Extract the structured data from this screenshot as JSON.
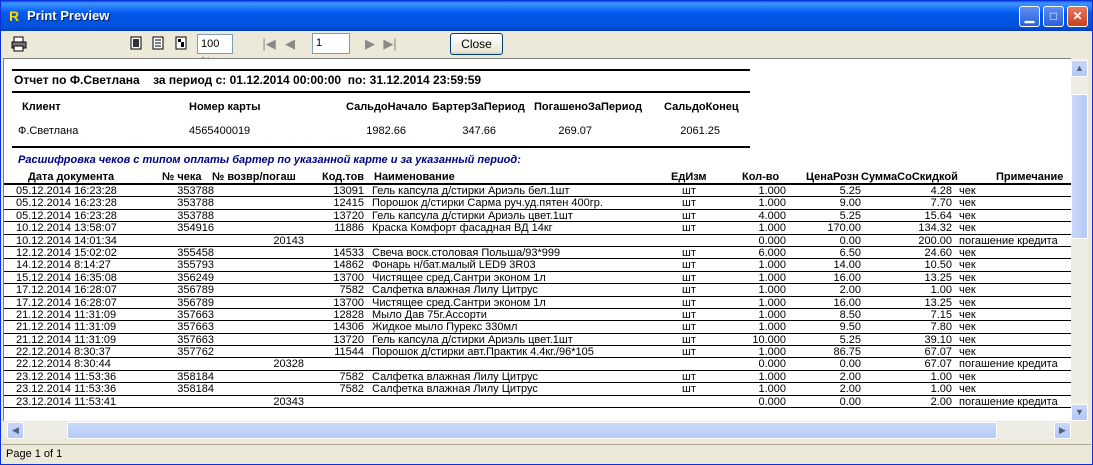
{
  "window": {
    "title": "Print Preview",
    "app_icon": "R"
  },
  "toolbar": {
    "zoom": "100 %",
    "page": "1",
    "close_label": "Close"
  },
  "report": {
    "header_line": "Отчет по Ф.Светлана    за период с: 01.12.2014 00:00:00  по: 31.12.2014 23:59:59",
    "summary_headers": [
      "Клиент",
      "Номер карты",
      "СальдоНачало",
      "БартерЗаПериод",
      "ПогашеноЗаПериод",
      "СальдоКонец"
    ],
    "summary_values": [
      "Ф.Светлана",
      "4565400019",
      "1982.66",
      "347.66",
      "269.07",
      "2061.25"
    ],
    "subtitle": "Расшифровка чеков с типом оплаты бартер по указанной карте и за указанный период:",
    "columns": [
      "Дата документа",
      "№ чека",
      "№ возвр/погаш",
      "Код.тов",
      "Наименование",
      "ЕдИзм",
      "Кол-во",
      "ЦенаРозн",
      "СуммаСоСкидкой",
      "Примечание"
    ],
    "rows": [
      [
        "05.12.2014 16:23:28",
        "353788",
        "",
        "13091",
        "Гель капсула д/стирки Ариэль бел.1шт",
        "шт",
        "1.000",
        "5.25",
        "4.28",
        "чек"
      ],
      [
        "05.12.2014 16:23:28",
        "353788",
        "",
        "12415",
        "Порошок д/стирки Сарма руч.уд.пятен 400гр.",
        "шт",
        "1.000",
        "9.00",
        "7.70",
        "чек"
      ],
      [
        "05.12.2014 16:23:28",
        "353788",
        "",
        "13720",
        "Гель капсула д/стирки Ариэль цвет.1шт",
        "шт",
        "4.000",
        "5.25",
        "15.64",
        "чек"
      ],
      [
        "10.12.2014 13:58:07",
        "354916",
        "",
        "11886",
        "Краска Комфорт фасадная ВД 14кг",
        "шт",
        "1.000",
        "170.00",
        "134.32",
        "чек"
      ],
      [
        "10.12.2014 14:01:34",
        "",
        "20143",
        "",
        "",
        "",
        "0.000",
        "0.00",
        "200.00",
        "погашение кредита"
      ],
      [
        "12.12.2014 15:02:02",
        "355458",
        "",
        "14533",
        "Свеча воск.столовая Польша/93*999",
        "шт",
        "6.000",
        "6.50",
        "24.60",
        "чек"
      ],
      [
        "14.12.2014 8:14:27",
        "355793",
        "",
        "14862",
        "Фонарь н/бат.малый LED9 3R03",
        "шт",
        "1.000",
        "14.00",
        "10.50",
        "чек"
      ],
      [
        "15.12.2014 16:35:08",
        "356249",
        "",
        "13700",
        "Чистящее сред.Сантри эконом 1л",
        "шт",
        "1.000",
        "16.00",
        "13.25",
        "чек"
      ],
      [
        "17.12.2014 16:28:07",
        "356789",
        "",
        "7582",
        "Салфетка влажная Лилу Цитрус",
        "шт",
        "1.000",
        "2.00",
        "1.00",
        "чек"
      ],
      [
        "17.12.2014 16:28:07",
        "356789",
        "",
        "13700",
        "Чистящее сред.Сантри эконом 1л",
        "шт",
        "1.000",
        "16.00",
        "13.25",
        "чек"
      ],
      [
        "21.12.2014 11:31:09",
        "357663",
        "",
        "12828",
        "Мыло Дав 75г.Ассорти",
        "шт",
        "1.000",
        "8.50",
        "7.15",
        "чек"
      ],
      [
        "21.12.2014 11:31:09",
        "357663",
        "",
        "14306",
        "Жидкое мыло Пурекс 330мл",
        "шт",
        "1.000",
        "9.50",
        "7.80",
        "чек"
      ],
      [
        "21.12.2014 11:31:09",
        "357663",
        "",
        "13720",
        "Гель капсула д/стирки Ариэль цвет.1шт",
        "шт",
        "10.000",
        "5.25",
        "39.10",
        "чек"
      ],
      [
        "22.12.2014 8:30:37",
        "357762",
        "",
        "11544",
        "Порошок д/стирки авт.Практик 4.4кг./96*105",
        "шт",
        "1.000",
        "86.75",
        "67.07",
        "чек"
      ],
      [
        "22.12.2014 8:30:44",
        "",
        "20328",
        "",
        "",
        "",
        "0.000",
        "0.00",
        "67.07",
        "погашение кредита"
      ],
      [
        "23.12.2014 11:53:36",
        "358184",
        "",
        "7582",
        "Салфетка влажная Лилу Цитрус",
        "шт",
        "1.000",
        "2.00",
        "1.00",
        "чек"
      ],
      [
        "23.12.2014 11:53:36",
        "358184",
        "",
        "7582",
        "Салфетка влажная Лилу Цитрус",
        "шт",
        "1.000",
        "2.00",
        "1.00",
        "чек"
      ],
      [
        "23.12.2014 11:53:41",
        "",
        "20343",
        "",
        "",
        "",
        "0.000",
        "0.00",
        "2.00",
        "погашение кредита"
      ]
    ]
  },
  "status": {
    "text": "Page 1 of 1"
  }
}
